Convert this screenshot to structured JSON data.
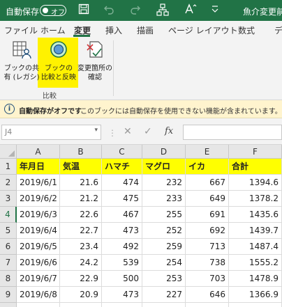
{
  "titlebar": {
    "autosave_label": "自動保存",
    "autosave_state": "オフ",
    "filename": "魚介変更前.."
  },
  "tabs": [
    {
      "label": "ファイル",
      "active": false
    },
    {
      "label": "ホーム",
      "active": false
    },
    {
      "label": "変更",
      "active": true
    },
    {
      "label": "挿入",
      "active": false
    },
    {
      "label": "描画",
      "active": false
    },
    {
      "label": "ページ レイアウト",
      "active": false
    },
    {
      "label": "数式",
      "active": false
    },
    {
      "label": "デ",
      "active": false
    }
  ],
  "ribbon": {
    "share_workbook": [
      "ブックの共",
      "有 (レガシ)"
    ],
    "compare_merge": [
      "ブックの",
      "比較と反映"
    ],
    "track_changes": [
      "変更箇所の",
      "確認"
    ],
    "group_label": "比較"
  },
  "infobar": {
    "bold": "自動保存がオフです",
    "text": "このブックには自動保存を使用できない機能が含まれています。ブックを手作業で"
  },
  "formula_bar": {
    "name_box": "J4",
    "fx": "fx",
    "content": ""
  },
  "grid": {
    "columns": [
      "A",
      "B",
      "C",
      "D",
      "E",
      "F"
    ],
    "selected_row": 4,
    "header": [
      "年月日",
      "気温",
      "ハマチ",
      "マグロ",
      "イカ",
      "合計"
    ],
    "rows": [
      [
        "2019/6/1",
        "21.6",
        "474",
        "232",
        "667",
        "1394.6"
      ],
      [
        "2019/6/2",
        "21.2",
        "475",
        "233",
        "649",
        "1378.2"
      ],
      [
        "2019/6/3",
        "22.6",
        "467",
        "255",
        "691",
        "1435.6"
      ],
      [
        "2019/6/4",
        "22.7",
        "473",
        "252",
        "692",
        "1439.7"
      ],
      [
        "2019/6/5",
        "23.4",
        "492",
        "259",
        "713",
        "1487.4"
      ],
      [
        "2019/6/6",
        "24.2",
        "539",
        "254",
        "738",
        "1555.2"
      ],
      [
        "2019/6/7",
        "22.9",
        "500",
        "253",
        "703",
        "1478.9"
      ],
      [
        "2019/6/8",
        "20.9",
        "473",
        "227",
        "646",
        "1366.9"
      ],
      [
        "2019/6/9",
        "21.6",
        "462",
        "245",
        "661",
        "1389.6"
      ]
    ]
  },
  "colors": {
    "title_bg": "#217346",
    "highlight": "#fff200",
    "header_fill": "#ffff00",
    "infobar_bg": "#fff4ce"
  }
}
